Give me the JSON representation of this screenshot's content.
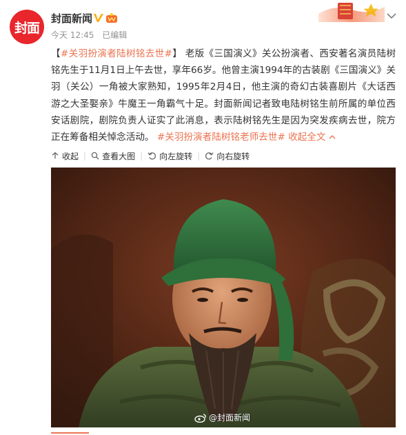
{
  "post": {
    "author": "封面新闻",
    "avatar_text": "封面",
    "time": "今天 12:45",
    "edited": "已编辑",
    "content": {
      "bracket_open": "【",
      "hashtag_1": "#关羽扮演者陆树铭去世#",
      "bracket_close": "】",
      "body": "老版《三国演义》关公扮演者、西安著名演员陆树铭先生于11月1日上午去世，享年66岁。他曾主演1994年的古装剧《三国演义》关羽（关公）一角被大家熟知，1995年2月4日，他主演的奇幻古装喜剧片《大话西游之大圣娶亲》牛魔王一角霸气十足。封面新闻记者致电陆树铭生前所属的单位西安话剧院，剧院负责人证实了此消息，表示陆树铭先生是因为突发疾病去世，院方正在筹备相关悼念活动。",
      "hashtag_2": "#关羽扮演者陆树铭老师去世#",
      "collapse": "收起全文"
    },
    "actions": {
      "collapse": "收起",
      "view_large": "查看大图",
      "rotate_left": "向左旋转",
      "rotate_right": "向右旋转"
    },
    "watermark": "@封面新闻"
  },
  "colors": {
    "accent": "#eb7350",
    "brand_red": "#e8262c",
    "meta_gray": "#939393"
  },
  "icons": {
    "verified": "verified-v-icon",
    "member": "member-crown-icon",
    "menu": "chevron-down-icon",
    "collapse": "arrow-up-icon",
    "zoom": "magnifier-icon",
    "rotate_left": "rotate-left-icon",
    "rotate_right": "rotate-right-icon",
    "weibo": "weibo-logo-icon"
  }
}
